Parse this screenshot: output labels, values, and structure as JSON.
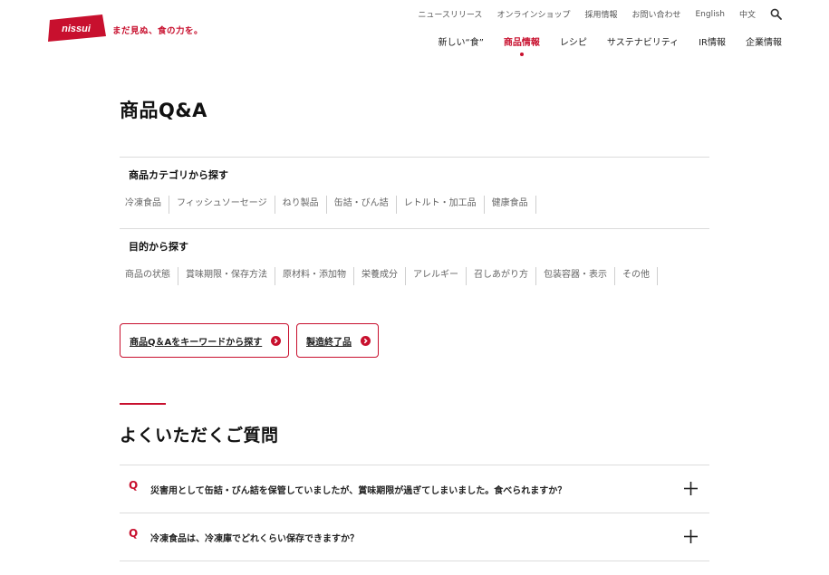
{
  "header": {
    "logo_text": "nissui",
    "tagline": "まだ見ぬ、食の力を。",
    "utility_links": [
      "ニュースリリース",
      "オンラインショップ",
      "採用情報",
      "お問い合わせ",
      "English",
      "中文"
    ],
    "main_nav": [
      {
        "label": "新しい“食”",
        "active": false
      },
      {
        "label": "商品情報",
        "active": true
      },
      {
        "label": "レシピ",
        "active": false
      },
      {
        "label": "サステナビリティ",
        "active": false
      },
      {
        "label": "IR情報",
        "active": false
      },
      {
        "label": "企業情報",
        "active": false
      }
    ]
  },
  "page": {
    "title": "商品Q&A"
  },
  "category_search": {
    "title": "商品カテゴリから探す",
    "links": [
      "冷凍食品",
      "フィッシュソーセージ",
      "ねり製品",
      "缶詰・びん詰",
      "レトルト・加工品",
      "健康食品"
    ]
  },
  "purpose_search": {
    "title": "目的から探す",
    "links": [
      "商品の状態",
      "賞味期限・保存方法",
      "原材料・添加物",
      "栄養成分",
      "アレルギー",
      "召しあがり方",
      "包装容器・表示",
      "その他"
    ]
  },
  "buttons": {
    "keyword_search": "商品Q＆Aをキーワードから探す",
    "discontinued": "製造終了品"
  },
  "faq": {
    "heading": "よくいただくご質問",
    "q_mark": "Q",
    "items": [
      "災害用として缶詰・びん詰を保管していましたが、賞味期限が過ぎてしまいました。食べられますか？",
      "冷凍食品は、冷凍庫でどれくらい保存できますか？"
    ]
  },
  "colors": {
    "accent": "#c8102e",
    "divider": "#dcdcdc",
    "text": "#222222"
  }
}
